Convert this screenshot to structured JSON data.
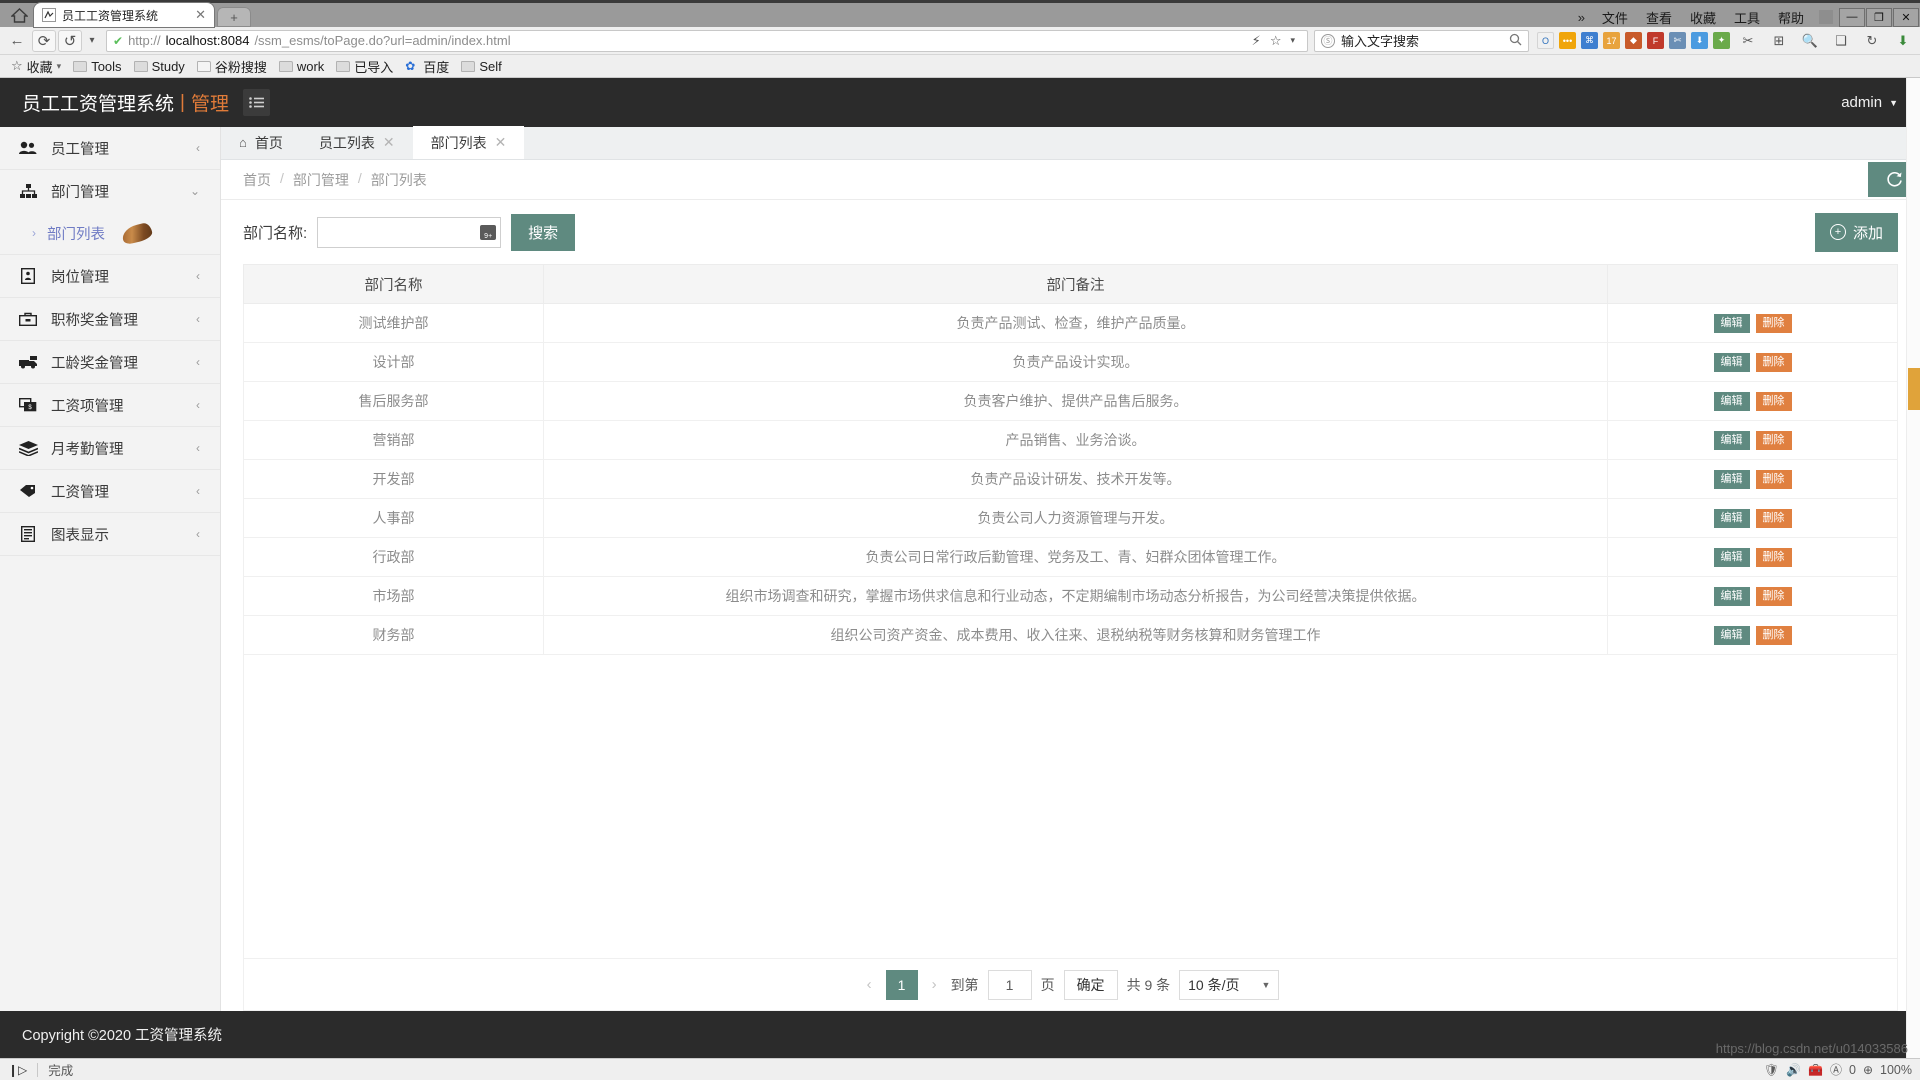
{
  "browser": {
    "tab": {
      "title": "员工工资管理系统",
      "close": "✕",
      "favicon": "site-favicon"
    },
    "newtab_label": "+",
    "window_menu": [
      "文件",
      "查看",
      "收藏",
      "工具",
      "帮助"
    ],
    "window_menu_overflow": "»",
    "window_buttons": [
      "—",
      "❐",
      "✕"
    ],
    "nav": {
      "back": "←",
      "reload": "⟳",
      "history": "↺",
      "dropdown": "▾"
    },
    "url": {
      "scheme": "http://",
      "host": "localhost:8084",
      "path": "/ssm_esms/toPage.do?url=admin/index.html"
    },
    "url_tools": {
      "lightning": "⚡",
      "star": "☆",
      "caret": "▾"
    },
    "search": {
      "engine": "Ⓢ",
      "placeholder": "输入文字搜索",
      "value": "",
      "icon": "search-icon"
    },
    "extensions": [
      {
        "name": "opera-ext",
        "glyph": "O",
        "color": "#f5f5f5",
        "fg": "#2b6fbb"
      },
      {
        "name": "orange-dots-ext",
        "glyph": "•••",
        "color": "#f0a50a",
        "fg": "#ffffff"
      },
      {
        "name": "blue-ext",
        "glyph": "⌘",
        "color": "#3e7fd0",
        "fg": "#ffffff"
      },
      {
        "name": "counter-ext",
        "glyph": "17",
        "color": "#e8a33d",
        "fg": "#ffffff"
      },
      {
        "name": "shield-ext",
        "glyph": "◆",
        "color": "#c85a2a",
        "fg": "#ffffff"
      },
      {
        "name": "red-ext",
        "glyph": "F",
        "color": "#c0392b",
        "fg": "#ffffff"
      },
      {
        "name": "screenshot-ext",
        "glyph": "✄",
        "color": "#6b8fb5",
        "fg": "#ffffff"
      },
      {
        "name": "download-ext",
        "glyph": "⬇",
        "color": "#4b9be0",
        "fg": "#ffffff"
      },
      {
        "name": "translate-ext",
        "glyph": "✦",
        "color": "#6aaa4a",
        "fg": "#ffffff"
      }
    ],
    "toolbar_right": [
      "✂",
      "⊞",
      "🔍",
      "❑",
      "↻",
      "⬇"
    ],
    "bookmarks": [
      {
        "label": "收藏",
        "icon": "star-icon",
        "caret": "▾"
      },
      {
        "label": "Tools",
        "icon": "folder-icon"
      },
      {
        "label": "Study",
        "icon": "folder-icon"
      },
      {
        "label": "谷粉搜搜",
        "icon": "folder-pale-icon"
      },
      {
        "label": "work",
        "icon": "folder-icon"
      },
      {
        "label": "已导入",
        "icon": "folder-icon"
      },
      {
        "label": "百度",
        "icon": "baidu-icon"
      },
      {
        "label": "Self",
        "icon": "folder-icon"
      }
    ]
  },
  "app": {
    "brand_primary": "员工工资管理系统",
    "brand_separator": "|",
    "brand_secondary": "管理",
    "hamburger_icon": "list-menu-icon",
    "user": "admin",
    "user_caret": "▼",
    "accent_teal": "#5f8a80",
    "accent_orange": "#e08040",
    "header_bg": "#2b2b2b"
  },
  "sidebar": {
    "items": [
      {
        "label": "员工管理",
        "icon": "users-icon",
        "arrow": "‹",
        "expanded": false
      },
      {
        "label": "部门管理",
        "icon": "sitemap-icon",
        "arrow": "⌄",
        "expanded": true
      },
      {
        "label": "岗位管理",
        "icon": "id-badge-icon",
        "arrow": "‹",
        "expanded": false
      },
      {
        "label": "职称奖金管理",
        "icon": "briefcase-icon",
        "arrow": "‹",
        "expanded": false
      },
      {
        "label": "工龄奖金管理",
        "icon": "truck-icon",
        "arrow": "‹",
        "expanded": false
      },
      {
        "label": "工资项管理",
        "icon": "money-bill-icon",
        "arrow": "‹",
        "expanded": false
      },
      {
        "label": "月考勤管理",
        "icon": "layers-icon",
        "arrow": "‹",
        "expanded": false
      },
      {
        "label": "工资管理",
        "icon": "tag-icon",
        "arrow": "‹",
        "expanded": false
      },
      {
        "label": "图表显示",
        "icon": "chart-list-icon",
        "arrow": "‹",
        "expanded": false
      }
    ],
    "sub_item": {
      "label": "部门列表",
      "caret": "›",
      "active": true,
      "cursor": "hand-cursor-icon"
    }
  },
  "tabs": [
    {
      "label": "首页",
      "icon": "home-icon",
      "closable": false,
      "active": false
    },
    {
      "label": "员工列表",
      "icon": "",
      "closable": true,
      "active": false,
      "close": "✕"
    },
    {
      "label": "部门列表",
      "icon": "",
      "closable": true,
      "active": true,
      "close": "✕"
    }
  ],
  "breadcrumb": {
    "items": [
      "首页",
      "部门管理",
      "部门列表"
    ],
    "separator": "/"
  },
  "refresh_button": {
    "name": "refresh-button",
    "icon": "refresh-icon",
    "glyph": "⟳"
  },
  "toolbar": {
    "search_label": "部门名称:",
    "search_value": "",
    "search_placeholder": "",
    "ime_icon": "ime-indicator-icon",
    "search_button": "搜索",
    "add_button": "添加",
    "add_icon": "plus-circle-icon"
  },
  "table": {
    "columns": [
      "部门名称",
      "部门备注",
      ""
    ],
    "edit_label": "编辑",
    "delete_label": "删除",
    "rows": [
      {
        "name": "测试维护部",
        "remark": "负责产品测试、检查，维护产品质量。"
      },
      {
        "name": "设计部",
        "remark": "负责产品设计实现。"
      },
      {
        "name": "售后服务部",
        "remark": "负责客户维护、提供产品售后服务。"
      },
      {
        "name": "营销部",
        "remark": "产品销售、业务洽谈。"
      },
      {
        "name": "开发部",
        "remark": "负责产品设计研发、技术开发等。"
      },
      {
        "name": "人事部",
        "remark": "负责公司人力资源管理与开发。"
      },
      {
        "name": "行政部",
        "remark": "负责公司日常行政后勤管理、党务及工、青、妇群众团体管理工作。"
      },
      {
        "name": "市场部",
        "remark": "组织市场调查和研究，掌握市场供求信息和行业动态，不定期编制市场动态分析报告，为公司经营决策提供依据。"
      },
      {
        "name": "财务部",
        "remark": "组织公司资产资金、成本费用、收入往来、退税纳税等财务核算和财务管理工作"
      }
    ]
  },
  "pagination": {
    "prev": "‹",
    "next": "›",
    "current_page": "1",
    "goto_label": "到第",
    "goto_value": "1",
    "page_unit": "页",
    "confirm": "确定",
    "total_text": "共 9 条",
    "page_size": "10 条/页",
    "page_size_caret": "▼"
  },
  "footer": {
    "copyright": "Copyright ©2020 工资管理系统"
  },
  "watermark": "https://blog.csdn.net/u014033586",
  "statusbar": {
    "play_icon": "play-step-icon",
    "text": "完成",
    "right_icons": [
      "shield-icon",
      "speaker-icon",
      "toolbox-icon",
      "ad-block-icon"
    ],
    "blocked_count": "0",
    "zoom_icon": "zoom-in-icon",
    "zoom": "100%"
  }
}
